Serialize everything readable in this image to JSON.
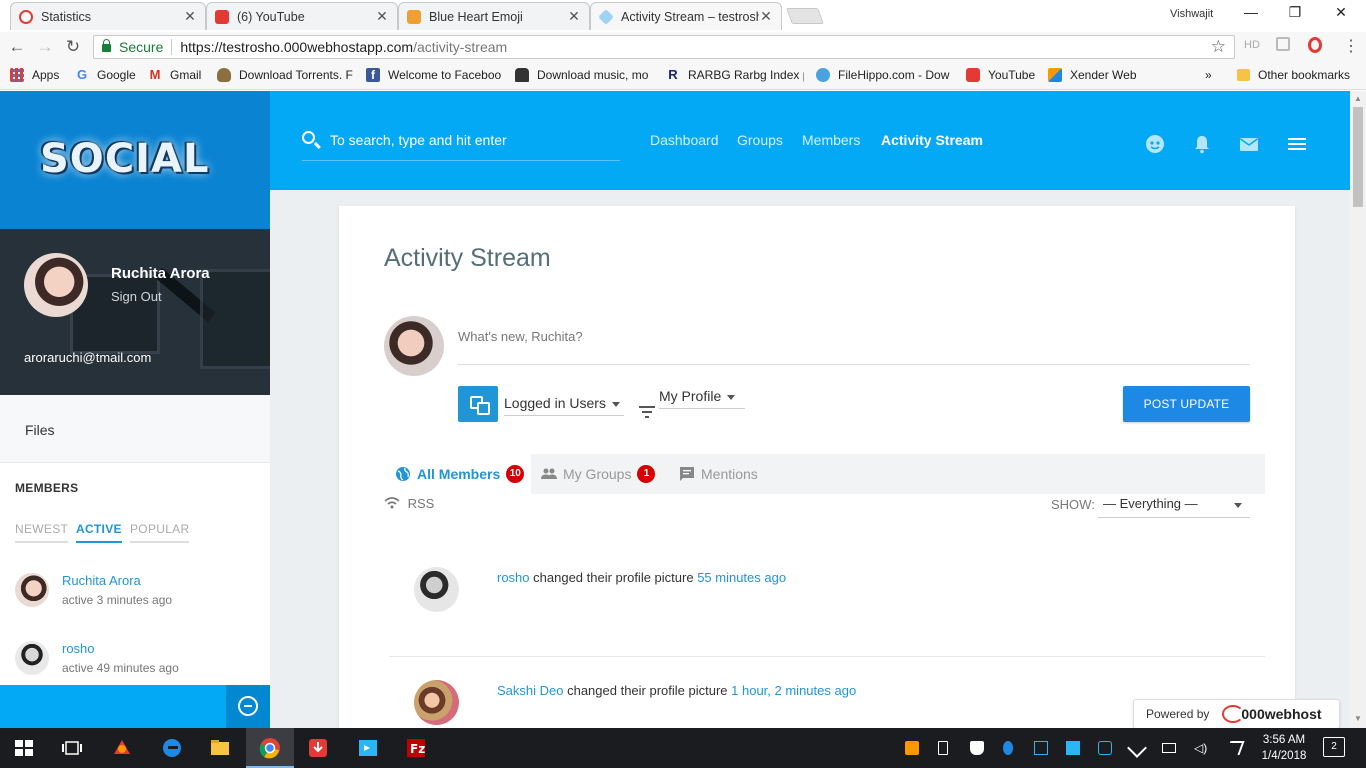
{
  "browser": {
    "tabs": [
      {
        "title": "Statistics",
        "active": false
      },
      {
        "title": "(6) YouTube",
        "active": false
      },
      {
        "title": "Blue Heart Emoji",
        "active": false
      },
      {
        "title": "Activity Stream – testrosh",
        "active": true
      }
    ],
    "profile_name": "Vishwajit",
    "window_controls": {
      "minimize": "—",
      "maximize": "❐",
      "close": "✕"
    },
    "omnibox": {
      "secure_label": "Secure",
      "url_host": "https://testrosho.000webhostapp.com",
      "url_path": "/activity-stream"
    },
    "extensions": {
      "hd": "HD"
    },
    "bookmarks": [
      {
        "label": "Apps"
      },
      {
        "label": "Google"
      },
      {
        "label": "Gmail"
      },
      {
        "label": "Download Torrents. F"
      },
      {
        "label": "Welcome to Faceboo"
      },
      {
        "label": "Download music, mo"
      },
      {
        "label": "RARBG Rarbg Index p"
      },
      {
        "label": "FileHippo.com - Dow"
      },
      {
        "label": "YouTube"
      },
      {
        "label": "Xender Web"
      }
    ],
    "bookmarks_overflow": "»",
    "other_bookmarks": "Other bookmarks"
  },
  "site": {
    "logo_text": "SOCIAL",
    "search_placeholder": "To search, type and hit enter",
    "nav": [
      {
        "label": "Dashboard"
      },
      {
        "label": "Groups"
      },
      {
        "label": "Members"
      },
      {
        "label": "Activity Stream"
      }
    ],
    "colors": {
      "primary": "#03a9f4",
      "sidebar_logo_bg": "#0a83d2",
      "link": "#2196d6",
      "badge": "#d50000",
      "button": "#1e88e5"
    }
  },
  "sidebar": {
    "user_name": "Ruchita Arora",
    "sign_out": "Sign Out",
    "email": "aroraruchi@tmail.com",
    "files_label": "Files",
    "members_title": "MEMBERS",
    "member_tabs": [
      {
        "label": "NEWEST"
      },
      {
        "label": "ACTIVE"
      },
      {
        "label": "POPULAR"
      }
    ],
    "members": [
      {
        "name": "Ruchita Arora",
        "activity": "active 3 minutes ago"
      },
      {
        "name": "rosho",
        "activity": "active 49 minutes ago"
      }
    ]
  },
  "main": {
    "title": "Activity Stream",
    "whats_new_placeholder": "What's new, Ruchita?",
    "visibility_select": "Logged in Users",
    "post_in_select": "My Profile",
    "post_button": "POST UPDATE",
    "stream_tabs": [
      {
        "label": "All Members",
        "count": "10"
      },
      {
        "label": "My Groups",
        "count": "1"
      },
      {
        "label": "Mentions",
        "count": ""
      }
    ],
    "rss_label": "RSS",
    "show_label": "SHOW:",
    "show_value": "— Everything —",
    "activities": [
      {
        "user": "rosho",
        "action": " changed their profile picture ",
        "time": "55 minutes ago"
      },
      {
        "user": "Sakshi Deo",
        "action": " changed their profile picture ",
        "time": "1 hour, 2 minutes ago"
      }
    ]
  },
  "powered_by": {
    "label": "Powered by",
    "brand": "000webhost"
  },
  "taskbar": {
    "time": "3:56 AM",
    "date": "1/4/2018",
    "notifications": "2"
  }
}
